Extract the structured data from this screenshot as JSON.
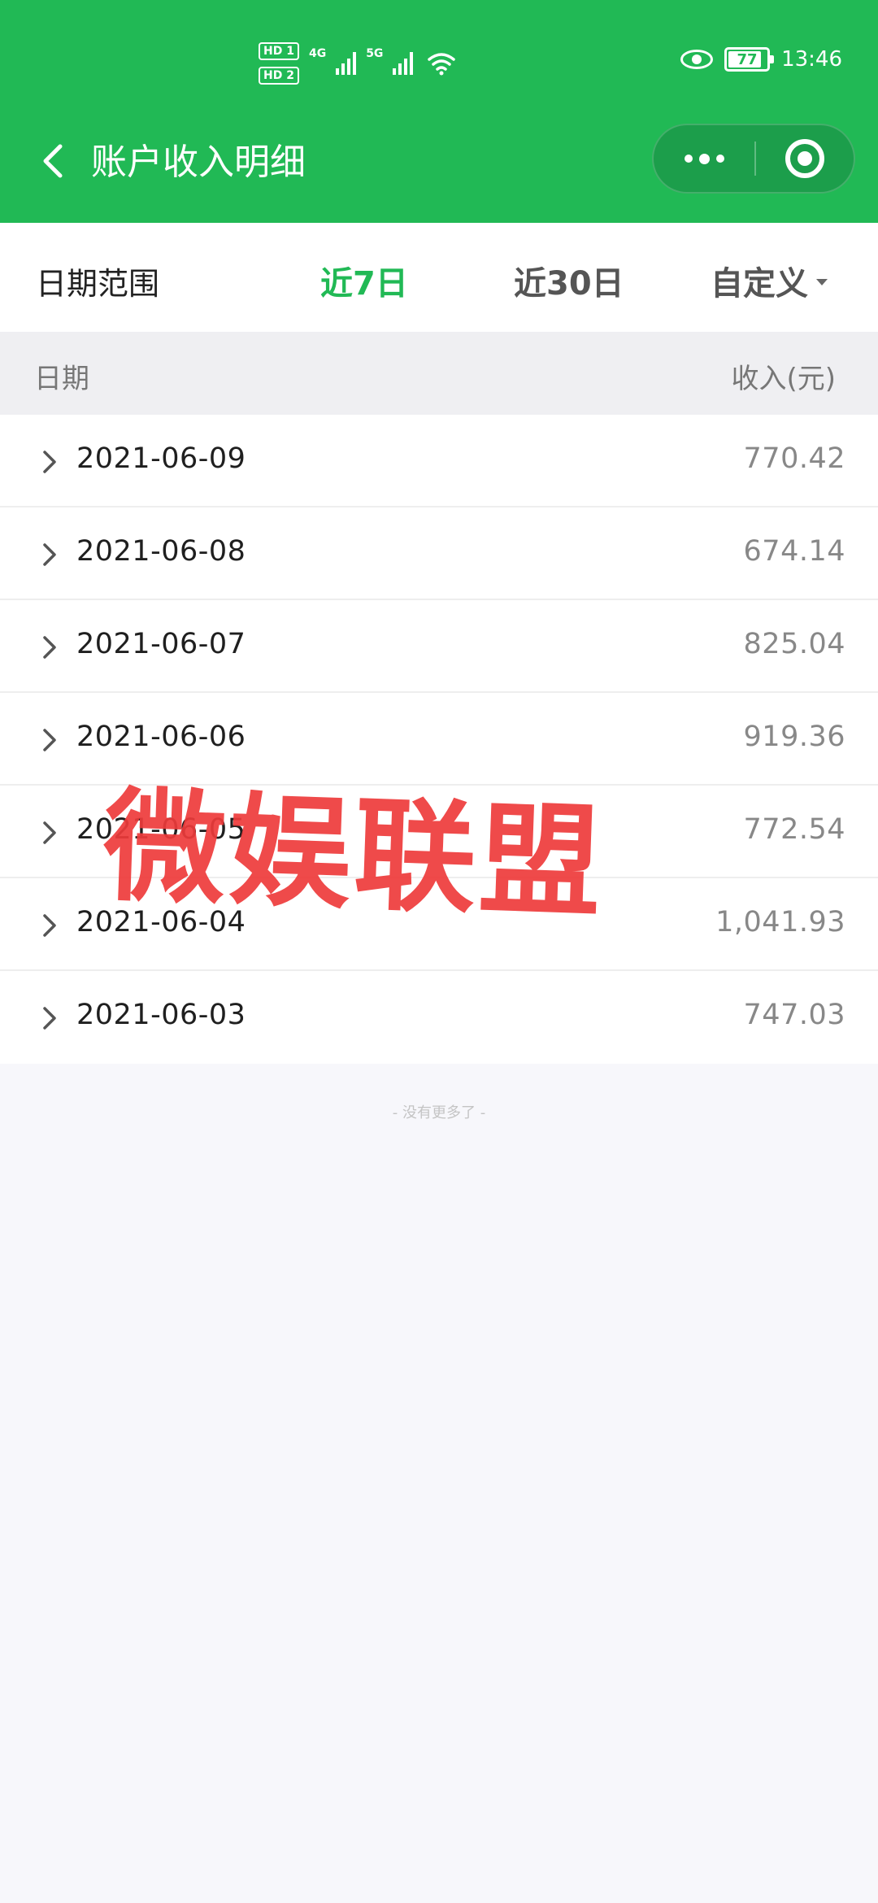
{
  "status_bar": {
    "hd1": "HD 1",
    "hd2": "HD 2",
    "net1": "4G",
    "net2": "5G",
    "battery": "77",
    "time": "13:46"
  },
  "nav": {
    "title": "账户收入明细",
    "back_icon": "chevron-left-icon",
    "more_icon": "more-dots-icon",
    "close_icon": "target-icon"
  },
  "filter": {
    "label": "日期范围",
    "options": [
      "近7日",
      "近30日",
      "自定义"
    ],
    "selected": "近7日",
    "accent": "#21b955"
  },
  "table": {
    "headers": {
      "date": "日期",
      "income": "收入(元)"
    },
    "rows": [
      {
        "date": "2021-06-09",
        "amount": "770.42"
      },
      {
        "date": "2021-06-08",
        "amount": "674.14"
      },
      {
        "date": "2021-06-07",
        "amount": "825.04"
      },
      {
        "date": "2021-06-06",
        "amount": "919.36"
      },
      {
        "date": "2021-06-05",
        "amount": "772.54"
      },
      {
        "date": "2021-06-04",
        "amount": "1,041.93"
      },
      {
        "date": "2021-06-03",
        "amount": "747.03"
      }
    ],
    "end_note": "- 没有更多了 -"
  },
  "watermark": "微娱联盟",
  "colors": {
    "header_bg": "#21b955",
    "watermark": "#ee3b3b"
  }
}
